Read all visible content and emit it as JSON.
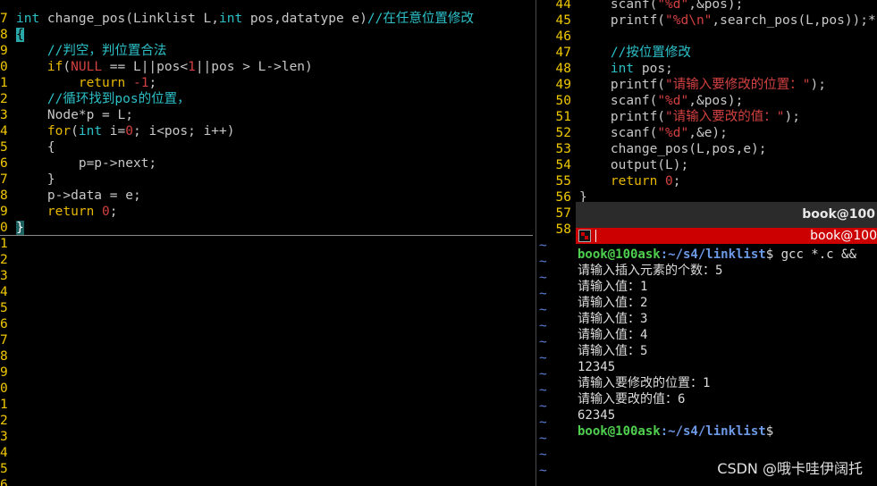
{
  "left_editor": {
    "lines": [
      {
        "num": "7",
        "parts": [
          [
            "t",
            "int"
          ],
          [
            "p",
            " change_pos(Linklist L,"
          ],
          [
            "t",
            "int"
          ],
          [
            "p",
            " pos,datatype e)"
          ],
          [
            "c",
            "//在任意位置修改"
          ]
        ]
      },
      {
        "num": "8",
        "parts": [
          [
            "cursor",
            "{"
          ]
        ]
      },
      {
        "num": "9",
        "parts": [
          [
            "p",
            "    "
          ],
          [
            "c",
            "//判空，判位置合法"
          ]
        ]
      },
      {
        "num": "0",
        "parts": [
          [
            "p",
            "    "
          ],
          [
            "k",
            "if"
          ],
          [
            "p",
            "("
          ],
          [
            "n",
            "NULL"
          ],
          [
            "p",
            " == L||pos<"
          ],
          [
            "n",
            "1"
          ],
          [
            "p",
            "||pos > L->len)"
          ]
        ]
      },
      {
        "num": "1",
        "parts": [
          [
            "p",
            "        "
          ],
          [
            "k",
            "return"
          ],
          [
            "p",
            " "
          ],
          [
            "n",
            "-1"
          ],
          [
            "p",
            ";"
          ]
        ]
      },
      {
        "num": "2",
        "parts": [
          [
            "p",
            "    "
          ],
          [
            "c",
            "//循环找到pos的位置，"
          ]
        ]
      },
      {
        "num": "3",
        "parts": [
          [
            "p",
            "    Node*p = L;"
          ]
        ]
      },
      {
        "num": "4",
        "parts": [
          [
            "p",
            "    "
          ],
          [
            "k",
            "for"
          ],
          [
            "p",
            "("
          ],
          [
            "t",
            "int"
          ],
          [
            "p",
            " i="
          ],
          [
            "n",
            "0"
          ],
          [
            "p",
            "; i<pos; i++)"
          ]
        ]
      },
      {
        "num": "5",
        "parts": [
          [
            "p",
            "    {"
          ]
        ]
      },
      {
        "num": "6",
        "parts": [
          [
            "p",
            "        p=p->next;"
          ]
        ]
      },
      {
        "num": "7",
        "parts": [
          [
            "p",
            "    }"
          ]
        ]
      },
      {
        "num": "8",
        "parts": [
          [
            "p",
            "    p->data = e;"
          ]
        ]
      },
      {
        "num": "9",
        "parts": [
          [
            "p",
            "    "
          ],
          [
            "k",
            "return"
          ],
          [
            "p",
            " "
          ],
          [
            "n",
            "0"
          ],
          [
            "p",
            ";"
          ]
        ]
      },
      {
        "num": "0",
        "parts": [
          [
            "hl",
            "}"
          ]
        ]
      },
      {
        "num": "1",
        "parts": []
      },
      {
        "num": "2",
        "parts": []
      },
      {
        "num": "3",
        "parts": []
      },
      {
        "num": "4",
        "parts": []
      },
      {
        "num": "5",
        "parts": []
      },
      {
        "num": "6",
        "parts": []
      },
      {
        "num": "7",
        "parts": []
      },
      {
        "num": "8",
        "parts": []
      },
      {
        "num": "9",
        "parts": []
      },
      {
        "num": "0",
        "parts": []
      },
      {
        "num": "1",
        "parts": []
      },
      {
        "num": "2",
        "parts": []
      },
      {
        "num": "3",
        "parts": []
      },
      {
        "num": "4",
        "parts": []
      },
      {
        "num": "5",
        "parts": []
      },
      {
        "num": "6",
        "parts": []
      }
    ]
  },
  "right_editor": {
    "lines": [
      {
        "num": "44",
        "parts": [
          [
            "p",
            "    scanf("
          ],
          [
            "s",
            "\"%d\""
          ],
          [
            "p",
            ",&pos);"
          ]
        ]
      },
      {
        "num": "45",
        "parts": [
          [
            "p",
            "    printf("
          ],
          [
            "s",
            "\"%d\\n\""
          ],
          [
            "p",
            ",search_pos(L,pos));*"
          ]
        ]
      },
      {
        "num": "46",
        "parts": []
      },
      {
        "num": "47",
        "parts": [
          [
            "p",
            "    "
          ],
          [
            "c",
            "//按位置修改"
          ]
        ]
      },
      {
        "num": "48",
        "parts": [
          [
            "p",
            "    "
          ],
          [
            "t",
            "int"
          ],
          [
            "p",
            " pos;"
          ]
        ]
      },
      {
        "num": "49",
        "parts": [
          [
            "p",
            "    printf("
          ],
          [
            "s",
            "\"请输入要修改的位置：\""
          ],
          [
            "p",
            ");"
          ]
        ]
      },
      {
        "num": "50",
        "parts": [
          [
            "p",
            "    scanf("
          ],
          [
            "s",
            "\"%d\""
          ],
          [
            "p",
            ",&pos);"
          ]
        ]
      },
      {
        "num": "51",
        "parts": [
          [
            "p",
            "    printf("
          ],
          [
            "s",
            "\"请输入要改的值：\""
          ],
          [
            "p",
            ");"
          ]
        ]
      },
      {
        "num": "52",
        "parts": [
          [
            "p",
            "    scanf("
          ],
          [
            "s",
            "\"%d\""
          ],
          [
            "p",
            ",&e);"
          ]
        ]
      },
      {
        "num": "53",
        "parts": [
          [
            "p",
            "    change_pos(L,pos,e);"
          ]
        ]
      },
      {
        "num": "54",
        "parts": [
          [
            "p",
            "    output(L);"
          ]
        ]
      },
      {
        "num": "55",
        "parts": [
          [
            "p",
            "    "
          ],
          [
            "k",
            "return"
          ],
          [
            "p",
            " "
          ],
          [
            "n",
            "0"
          ],
          [
            "p",
            ";"
          ]
        ]
      },
      {
        "num": "56",
        "parts": [
          [
            "p",
            "}"
          ]
        ]
      },
      {
        "num": "57",
        "parts": []
      },
      {
        "num": "58",
        "parts": []
      }
    ],
    "tilde_count": 15
  },
  "terminal": {
    "title": "book@100",
    "tab_title": "book@100",
    "lines": [
      {
        "user": "book@100ask",
        "path": ":~/s4/linklist",
        "cmd": "$ gcc *.c &&"
      },
      {
        "text": "请输入插入元素的个数：5"
      },
      {
        "text": "请输入值：1"
      },
      {
        "text": "请输入值：2"
      },
      {
        "text": "请输入值：3"
      },
      {
        "text": "请输入值：4"
      },
      {
        "text": "请输入值：5"
      },
      {
        "text": "12345"
      },
      {
        "text": "请输入要修改的位置：1"
      },
      {
        "text": "请输入要改的值：6"
      },
      {
        "text": "62345"
      },
      {
        "user": "book@100ask",
        "path": ":~/s4/linklist",
        "cmd": "$"
      }
    ]
  },
  "watermark": "CSDN @哦卡哇伊阔托"
}
